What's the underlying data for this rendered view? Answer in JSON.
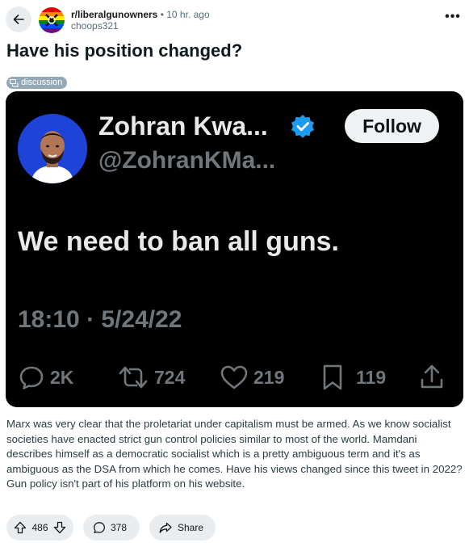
{
  "header": {
    "subreddit": "r/liberalgunowners",
    "separator": "•",
    "time": "10 hr. ago",
    "username": "choops321",
    "more": "•••"
  },
  "post": {
    "title": "Have his position changed?",
    "flair": "discussion",
    "body": "Marx was very clear that the proletariat under capitalism must be armed. As we know socialist societies have enacted strict gun control policies similar to most of the world. Mamdani describes himself as a democratic socialist which is a pretty ambiguous term and it's as ambiguous as the DSA from which he comes. Have his views changed since this tweet in 2022? Gun policy isn't part of his platform on his website."
  },
  "tweet": {
    "name": "Zohran Kwa...",
    "handle": "@ZohranKMa...",
    "follow_label": "Follow",
    "text": "We need to ban all guns.",
    "timestamp": "18:10 · 5/24/22",
    "replies": "2K",
    "retweets": "724",
    "likes": "219",
    "bookmarks": "119",
    "colors": {
      "background": "#000000",
      "verified": "#1d9bf0",
      "avatar_bg": "#1d43d8"
    }
  },
  "actions": {
    "votes": "486",
    "comments": "378",
    "share_label": "Share"
  },
  "icons": [
    "back-arrow-icon",
    "subreddit-avatar-icon",
    "more-icon",
    "flair-chat-icon",
    "verified-badge-icon",
    "reply-icon",
    "retweet-icon",
    "like-icon",
    "bookmark-icon",
    "share-tweet-icon",
    "upvote-icon",
    "downvote-icon",
    "comment-icon",
    "share-icon"
  ]
}
